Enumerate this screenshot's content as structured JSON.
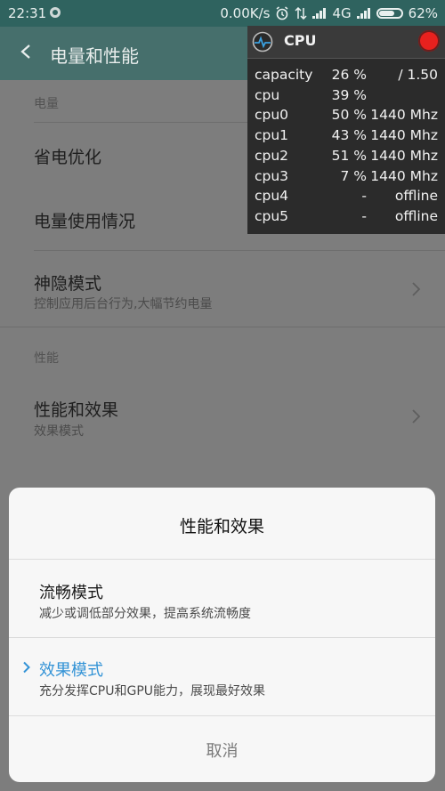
{
  "status": {
    "time": "22:31",
    "speed": "0.00K/s",
    "network": "4G",
    "battery": "62%"
  },
  "header": {
    "title": "电量和性能"
  },
  "list": {
    "section_power": "电量",
    "power_saving": "省电优化",
    "battery_usage": "电量使用情况",
    "hidden_mode_title": "神隐模式",
    "hidden_mode_sub": "控制应用后台行为,大幅节约电量",
    "section_performance": "性能",
    "perf_title": "性能和效果",
    "perf_sub": "效果模式"
  },
  "cpu_overlay": {
    "title": "CPU",
    "rows": [
      {
        "name": "capacity",
        "value": "26 %",
        "extra": "/ 1.50"
      },
      {
        "name": "cpu",
        "value": "39 %",
        "extra": ""
      },
      {
        "name": "cpu0",
        "value": "50 %",
        "extra": "1440 Mhz"
      },
      {
        "name": "cpu1",
        "value": "43 %",
        "extra": "1440 Mhz"
      },
      {
        "name": "cpu2",
        "value": "51 %",
        "extra": "1440 Mhz"
      },
      {
        "name": "cpu3",
        "value": "7 %",
        "extra": "1440 Mhz"
      },
      {
        "name": "cpu4",
        "value": "-",
        "extra": "offline"
      },
      {
        "name": "cpu5",
        "value": "-",
        "extra": "offline"
      }
    ]
  },
  "dialog": {
    "title": "性能和效果",
    "options": [
      {
        "title": "流畅模式",
        "subtitle": "减少或调低部分效果，提高系统流畅度",
        "selected": false
      },
      {
        "title": "效果模式",
        "subtitle": "充分发挥CPU和GPU能力，展现最好效果",
        "selected": true
      }
    ],
    "cancel": "取消"
  },
  "colors": {
    "accent": "#3393d6",
    "header": "#466f6c",
    "statusbar": "#2f635f",
    "record": "#e8211e"
  }
}
